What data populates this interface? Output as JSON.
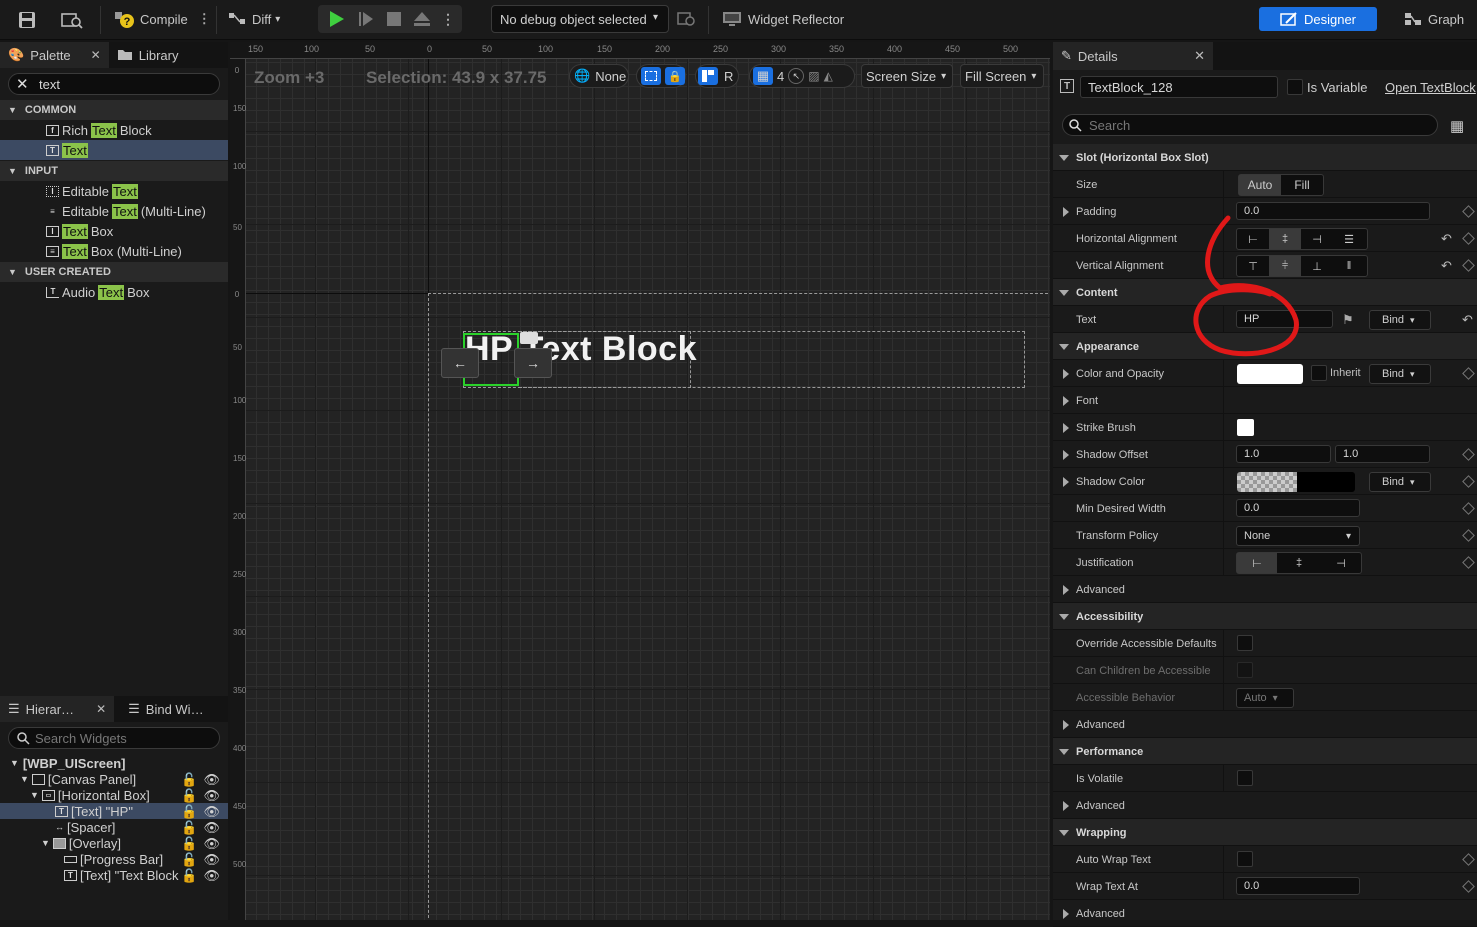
{
  "toolbar": {
    "compile_label": "Compile",
    "diff_label": "Diff",
    "debug_select": "No debug object selected",
    "widget_reflector": "Widget Reflector",
    "designer_label": "Designer",
    "graph_label": "Graph"
  },
  "palette": {
    "tab_palette": "Palette",
    "tab_library": "Library",
    "search_value": "text",
    "highlight": "Text",
    "categories": {
      "common": "COMMON",
      "input": "INPUT",
      "user_created": "USER CREATED"
    },
    "items": [
      {
        "pre": "Rich ",
        "post": " Block",
        "icon": "rich-text-icon"
      },
      {
        "pre": "",
        "post": "",
        "icon": "text-icon"
      },
      {
        "pre": "Editable ",
        "post": "",
        "icon": "editable-text-icon"
      },
      {
        "pre": "Editable ",
        "post": " (Multi-Line)",
        "icon": "editable-multiline-icon"
      },
      {
        "pre": "",
        "post": " Box",
        "icon": "text-box-icon"
      },
      {
        "pre": "",
        "post": " Box (Multi-Line)",
        "icon": "text-box-multiline-icon"
      },
      {
        "pre": "Audio ",
        "post": " Box",
        "icon": "audio-text-box-icon"
      }
    ]
  },
  "hierarchy": {
    "tab_hierarchy": "Hierar…",
    "tab_bind": "Bind Wi…",
    "search_placeholder": "Search Widgets",
    "rows": [
      "[WBP_UIScreen]",
      "[Canvas Panel]",
      "[Horizontal Box]",
      "[Text] \"HP\"",
      "[Spacer]",
      "[Overlay]",
      "[Progress Bar]",
      "[Text] \"Text Block"
    ]
  },
  "canvas": {
    "zoom": "Zoom +3",
    "selection": "Selection: 43.9 x 37.75",
    "none_label": "None",
    "r_label": "R",
    "grid_value": "4",
    "screen_size": "Screen Size",
    "fill_screen": "Fill Screen",
    "widget_text_hp": "HP",
    "widget_text_block": "Text Block",
    "ruler_top": [
      "150",
      "100",
      "50",
      "0",
      "50",
      "100",
      "150",
      "200",
      "250",
      "300",
      "350",
      "400",
      "450",
      "500"
    ],
    "ruler_left": [
      "0",
      "150",
      "100",
      "50",
      "0",
      "50",
      "100",
      "150",
      "200",
      "250",
      "300",
      "350",
      "400",
      "450",
      "500"
    ]
  },
  "details": {
    "tab": "Details",
    "widget_name": "TextBlock_128",
    "is_variable": "Is Variable",
    "open_link": "Open TextBlock",
    "search_placeholder": "Search",
    "slot_section": "Slot (Horizontal Box Slot)",
    "size_label": "Size",
    "size_auto": "Auto",
    "size_fill": "Fill",
    "padding_label": "Padding",
    "padding_value": "0.0",
    "h_align_label": "Horizontal Alignment",
    "v_align_label": "Vertical Alignment",
    "content_section": "Content",
    "text_label": "Text",
    "text_value": "HP",
    "bind": "Bind",
    "appearance_section": "Appearance",
    "color_label": "Color and Opacity",
    "inherit_label": "Inherit",
    "font_label": "Font",
    "strike_label": "Strike Brush",
    "shadow_offset_label": "Shadow Offset",
    "shadow_offset_x": "1.0",
    "shadow_offset_y": "1.0",
    "shadow_color_label": "Shadow Color",
    "min_width_label": "Min Desired Width",
    "min_width_value": "0.0",
    "transform_label": "Transform Policy",
    "transform_value": "None",
    "justification_label": "Justification",
    "advanced_label": "Advanced",
    "accessibility_section": "Accessibility",
    "override_label": "Override Accessible Defaults",
    "children_label": "Can Children be Accessible",
    "behavior_label": "Accessible Behavior",
    "behavior_value": "Auto",
    "performance_section": "Performance",
    "volatile_label": "Is Volatile",
    "wrapping_section": "Wrapping",
    "auto_wrap_label": "Auto Wrap Text",
    "wrap_at_label": "Wrap Text At",
    "wrap_at_value": "0.0"
  },
  "colors": {
    "accent": "#1a6fe0",
    "highlight": "#8bc34a",
    "selection": "#3c4a62",
    "annotation": "#e01818"
  }
}
